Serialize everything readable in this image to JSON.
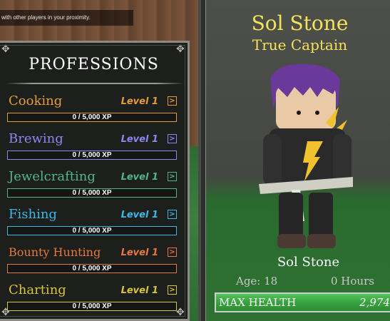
{
  "notice": {
    "text": "with other players in your proximity."
  },
  "professions": {
    "title": "PROFESSIONS",
    "items": [
      {
        "name": "Cooking",
        "level": "Level 1",
        "xp": "0 / 5,000 XP",
        "progress": 0,
        "color": "#e39a3b",
        "icon": "chevron-right-icon"
      },
      {
        "name": "Brewing",
        "level": "Level 1",
        "xp": "0 / 5,000 XP",
        "progress": 0,
        "color": "#8f86f2",
        "icon": "chevron-right-icon"
      },
      {
        "name": "Jewelcrafting",
        "level": "Level 1",
        "xp": "0 / 5,000 XP",
        "progress": 0,
        "color": "#4fb58a",
        "icon": "chevron-right-icon"
      },
      {
        "name": "Fishing",
        "level": "Level 1",
        "xp": "0 / 5,000 XP",
        "progress": 0,
        "color": "#3bb8e6",
        "icon": "chevron-right-icon"
      },
      {
        "name": "Bounty Hunting",
        "level": "Level 1",
        "xp": "0 / 5,000 XP",
        "progress": 0,
        "color": "#e8783b",
        "icon": "chevron-right-icon"
      },
      {
        "name": "Charting",
        "level": "Level 1",
        "xp": "0 / 5,000 XP",
        "progress": 0,
        "color": "#d8c43a",
        "icon": "chevron-right-icon"
      }
    ]
  },
  "character": {
    "name": "Sol Stone",
    "title": "True Captain",
    "display_name": "Sol Stone",
    "age": "Age: 18",
    "hours": "0 Hours",
    "name_color": "#f4e25a",
    "health": {
      "label": "MAX HEALTH",
      "value": "2,974",
      "fill": 1.0
    }
  }
}
